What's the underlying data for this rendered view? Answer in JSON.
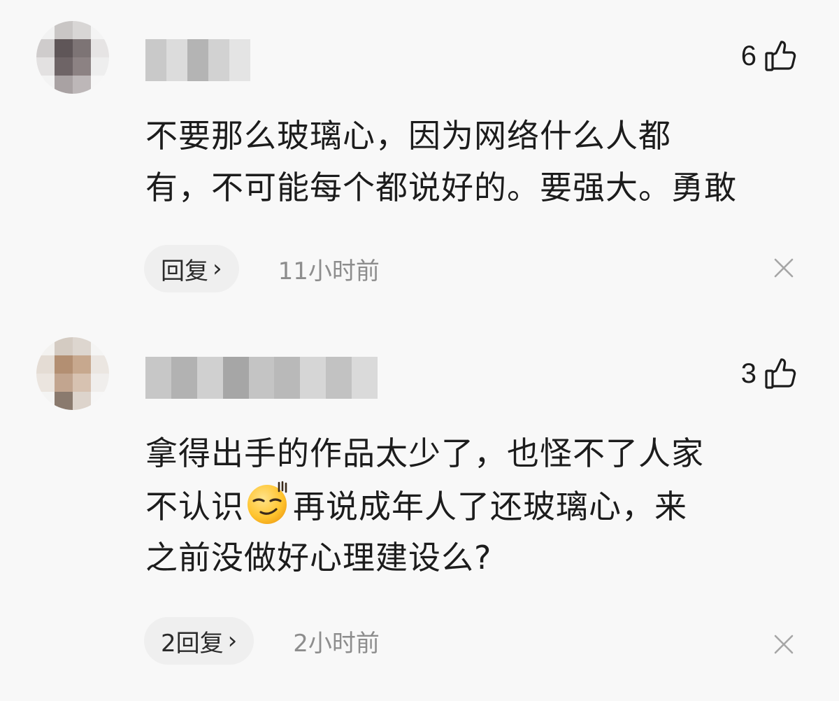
{
  "comments": [
    {
      "like_count": "6",
      "text_lines": [
        "不要那么玻璃心，因为网络什么人都",
        "有，不可能每个都说好的。要强大。勇敢"
      ],
      "reply_label": "回复",
      "timestamp": "11小时前"
    },
    {
      "like_count": "3",
      "text_lines": [
        "拿得出手的作品太少了，也怪不了人家",
        "不认识",
        "再说成年人了还玻璃心，来",
        "之前没做好心理建设么?"
      ],
      "reply_label": "2回复",
      "timestamp": "2小时前"
    }
  ],
  "icons": {
    "like": "thumbs-up-icon",
    "close": "close-icon",
    "chevron": "chevron-right-icon",
    "emoji": "smirk-emoji-icon"
  },
  "chevron_glyph": "›",
  "colors": {
    "background": "#f8f8f8",
    "text": "#1c1c1c",
    "muted": "#8d8d8d",
    "reply_bg": "#efefef"
  }
}
